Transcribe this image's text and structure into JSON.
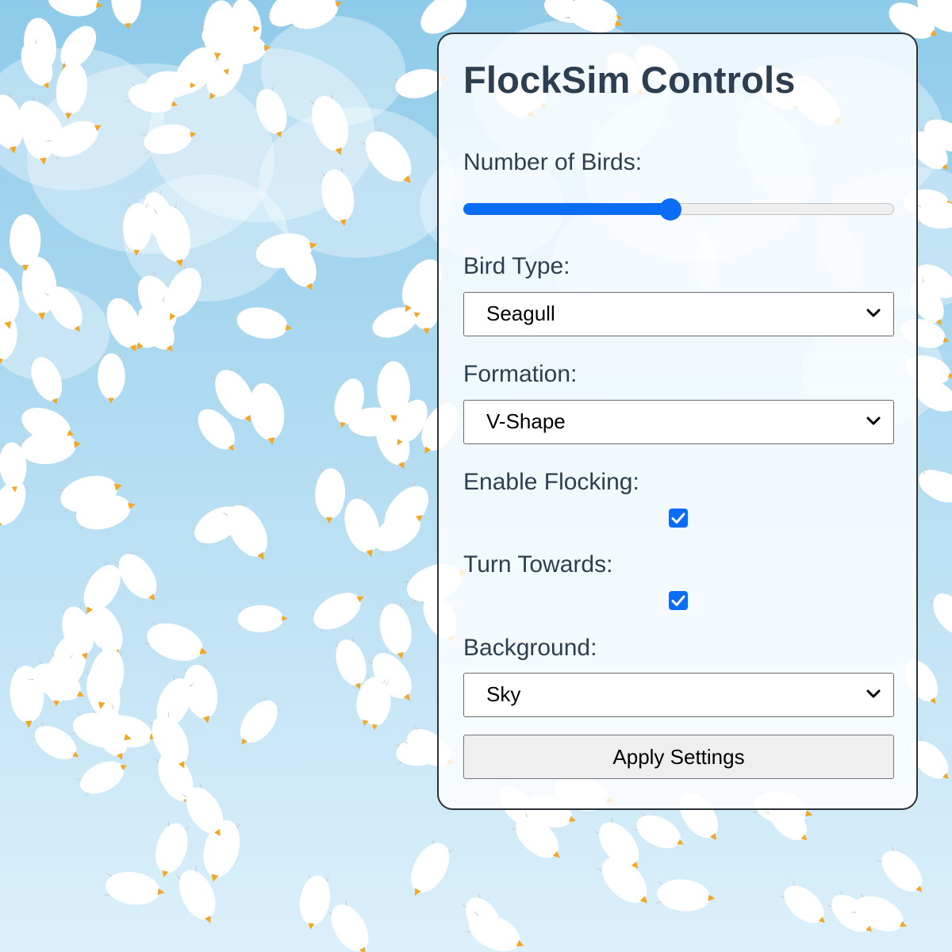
{
  "panel": {
    "title": "FlockSim Controls",
    "birds": {
      "label": "Number of Birds:",
      "fraction": 0.48
    },
    "bird_type": {
      "label": "Bird Type:",
      "selected": "Seagull"
    },
    "formation": {
      "label": "Formation:",
      "selected": "V-Shape"
    },
    "flocking": {
      "label": "Enable Flocking:",
      "checked": true
    },
    "turn_towards": {
      "label": "Turn Towards:",
      "checked": true
    },
    "background": {
      "label": "Background:",
      "selected": "Sky"
    },
    "apply_label": "Apply Settings"
  },
  "colors": {
    "sky_top": "#8ecbea",
    "sky_bottom": "#dcf0fb",
    "accent": "#0b6cf6",
    "title": "#2c3e50",
    "beak": "#f5a623"
  }
}
